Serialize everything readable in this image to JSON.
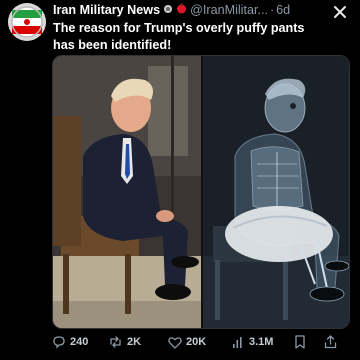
{
  "tweet": {
    "author_name": "Iran Military News",
    "handle": "@IranMilitar...",
    "separator": "·",
    "time": "6d",
    "text": "The reason for Trump's overly puffy pants has been identified!"
  },
  "actions": {
    "replies": "240",
    "reposts": "2K",
    "likes": "20K",
    "views": "3.1M"
  },
  "colors": {
    "background": "#000000",
    "text": "#e7e9ea",
    "muted": "#8b98a5",
    "flag_green": "#239f40",
    "flag_red": "#da0000"
  },
  "icons": [
    "close-icon",
    "verified-emblem-icon",
    "apple-emoji-icon",
    "reply-icon",
    "repost-icon",
    "like-icon",
    "views-icon",
    "bookmark-icon",
    "share-icon"
  ]
}
